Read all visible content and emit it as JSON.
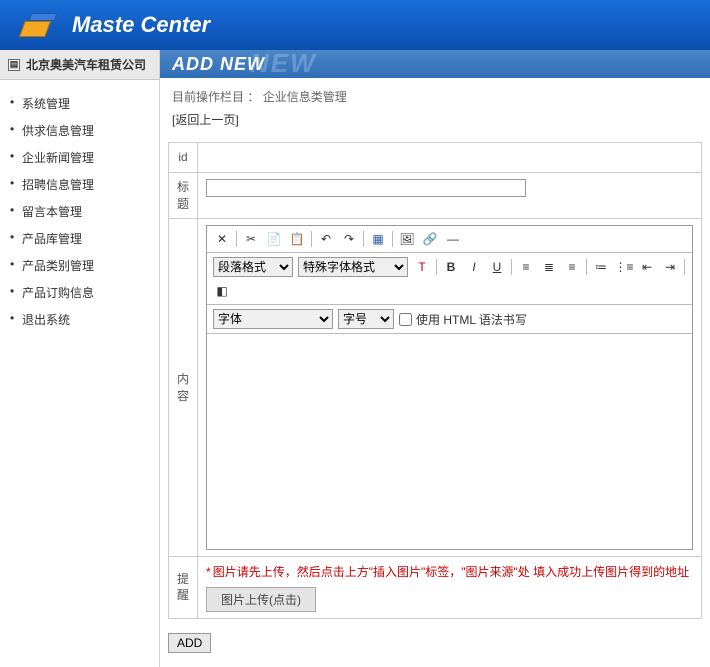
{
  "header": {
    "brand": "Maste Center"
  },
  "sidebar": {
    "title": "北京奥美汽车租赁公司",
    "items": [
      {
        "label": "系统管理"
      },
      {
        "label": "供求信息管理"
      },
      {
        "label": "企业新闻管理"
      },
      {
        "label": "招聘信息管理"
      },
      {
        "label": "留言本管理"
      },
      {
        "label": "产品库管理"
      },
      {
        "label": "产品类别管理"
      },
      {
        "label": "产品订购信息"
      },
      {
        "label": "退出系统"
      }
    ]
  },
  "main": {
    "bar_title": "ADD NEW",
    "bar_bg": "NEW",
    "breadcrumb_label": "目前操作栏目 ：",
    "breadcrumb_value": "企业信息类管理",
    "back_text": "[返回上一页]",
    "form": {
      "id_label": "id",
      "id_value": "",
      "title_label": "标题",
      "title_value": "",
      "content_label": "内容",
      "reminder_label": "提醒",
      "reminder_text": "图片请先上传，然后点击上方\"插入图片\"标签，\"图片来源\"处 填入成功上传图片得到的地址",
      "upload_label": "图片上传(点击)"
    },
    "editor": {
      "sel_block": "段落格式",
      "sel_format": "特殊字体格式",
      "sel_font": "字体",
      "sel_size": "字号",
      "chk_html": "使用 HTML 语法书写"
    },
    "submit": "ADD"
  }
}
